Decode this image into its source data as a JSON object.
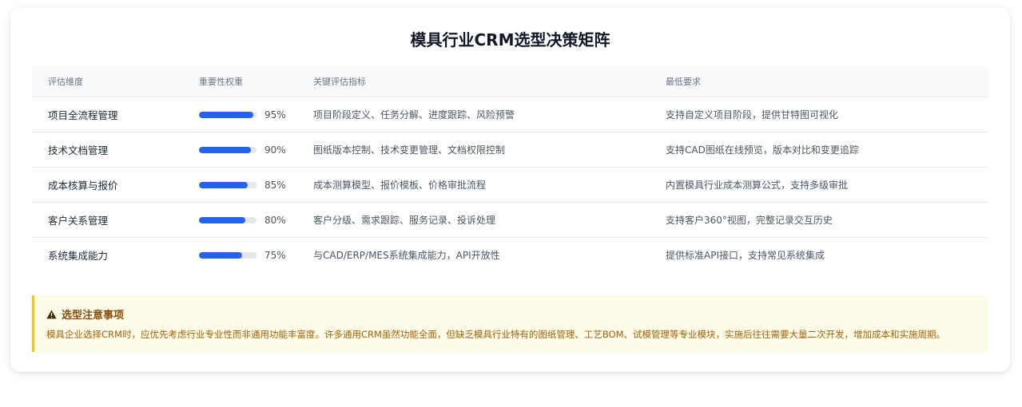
{
  "title": "模具行业CRM选型决策矩阵",
  "table": {
    "headers": [
      "评估维度",
      "重要性权重",
      "关键评估指标",
      "最低要求"
    ],
    "rows": [
      {
        "dimension": "项目全流程管理",
        "weight": 95,
        "weight_label": "95%",
        "indicators": "项目阶段定义、任务分解、进度跟踪、风险预警",
        "requirement": "支持自定义项目阶段，提供甘特图可视化"
      },
      {
        "dimension": "技术文档管理",
        "weight": 90,
        "weight_label": "90%",
        "indicators": "图纸版本控制、技术变更管理、文档权限控制",
        "requirement": "支持CAD图纸在线预览，版本对比和变更追踪"
      },
      {
        "dimension": "成本核算与报价",
        "weight": 85,
        "weight_label": "85%",
        "indicators": "成本测算模型、报价模板、价格审批流程",
        "requirement": "内置模具行业成本测算公式，支持多级审批"
      },
      {
        "dimension": "客户关系管理",
        "weight": 80,
        "weight_label": "80%",
        "indicators": "客户分级、需求跟踪、服务记录、投诉处理",
        "requirement": "支持客户360°视图，完整记录交互历史"
      },
      {
        "dimension": "系统集成能力",
        "weight": 75,
        "weight_label": "75%",
        "indicators": "与CAD/ERP/MES系统集成能力，API开放性",
        "requirement": "提供标准API接口，支持常见系统集成"
      }
    ]
  },
  "notice": {
    "icon": "warning-icon",
    "title": "选型注意事项",
    "text": "模具企业选择CRM时，应优先考虑行业专业性而非通用功能丰富度。许多通用CRM虽然功能全面，但缺乏模具行业特有的图纸管理、工艺BOM、试模管理等专业模块，实施后往往需要大量二次开发，增加成本和实施周期。"
  },
  "colors": {
    "bar": "#2563eb",
    "bar_track": "#e5e7eb",
    "notice_bg": "#fefbe8",
    "notice_border": "#f5c518",
    "notice_text": "#a16207"
  }
}
